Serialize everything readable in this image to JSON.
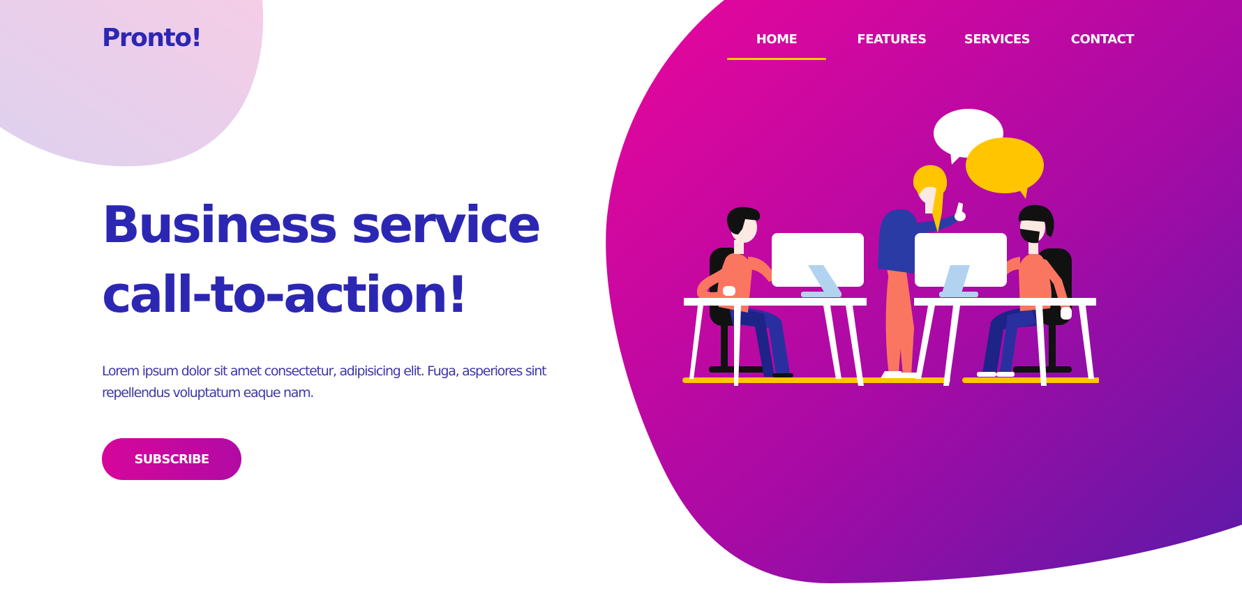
{
  "brand": {
    "name": "Pronto!"
  },
  "nav": {
    "items": [
      {
        "label": "HOME",
        "active": true
      },
      {
        "label": "FEATURES",
        "active": false
      },
      {
        "label": "SERVICES",
        "active": false
      },
      {
        "label": "CONTACT",
        "active": false
      }
    ]
  },
  "hero": {
    "headline_line1": "Business service",
    "headline_line2": "call-to-action!",
    "description": "Lorem ipsum dolor sit amet consectetur, adipisicing elit. Fuga, asperiores sint repellendus voluptatum eaque nam.",
    "cta_label": "SUBSCRIBE"
  },
  "colors": {
    "brand_blue": "#2c27b3",
    "magenta": "#e4079c",
    "purple": "#5a1aa8",
    "nav_underline": "#ffcc00",
    "speech_bubble_yellow": "#ffc600",
    "shirt_coral": "#fb7660"
  },
  "icons": [
    "logo-blob",
    "speech-bubble-icon",
    "monitor-icon"
  ]
}
